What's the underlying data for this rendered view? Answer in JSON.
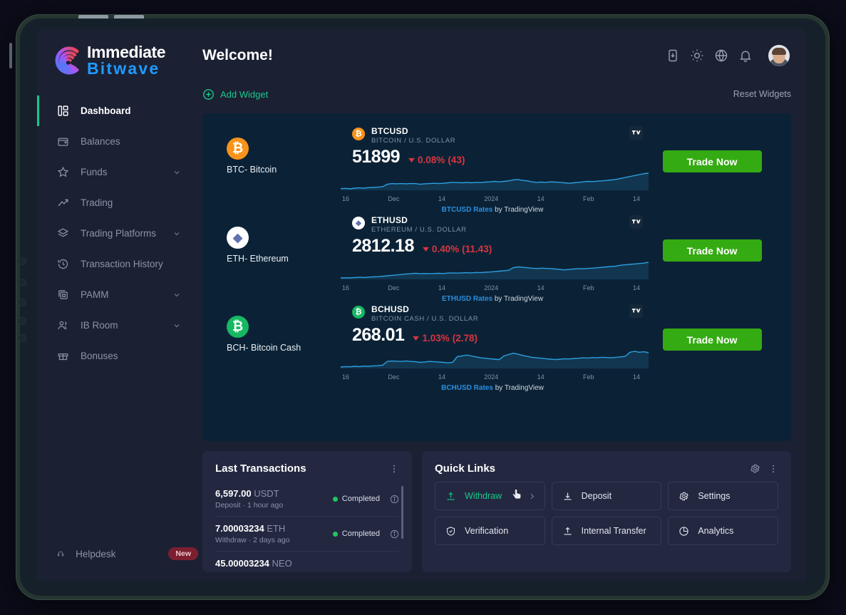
{
  "brand": {
    "line1": "Immediate",
    "line2": "Bitwave"
  },
  "header": {
    "title": "Welcome!",
    "icons": [
      "deposit-icon",
      "theme-sun-icon",
      "language-globe-icon",
      "notification-bell-icon"
    ],
    "avatar_alt": "user-avatar"
  },
  "widgetbar": {
    "add_label": "Add Widget",
    "reset_label": "Reset Widgets"
  },
  "sidebar": {
    "items": [
      {
        "label": "Dashboard",
        "icon": "dashboard-icon",
        "active": true,
        "expandable": false
      },
      {
        "label": "Balances",
        "icon": "wallet-icon",
        "active": false,
        "expandable": false
      },
      {
        "label": "Funds",
        "icon": "star-icon",
        "active": false,
        "expandable": true
      },
      {
        "label": "Trading",
        "icon": "trend-up-icon",
        "active": false,
        "expandable": false
      },
      {
        "label": "Trading Platforms",
        "icon": "layers-icon",
        "active": false,
        "expandable": true
      },
      {
        "label": "Transaction History",
        "icon": "history-clock-icon",
        "active": false,
        "expandable": false
      },
      {
        "label": "PAMM",
        "icon": "copy-box-icon",
        "active": false,
        "expandable": true
      },
      {
        "label": "IB Room",
        "icon": "users-icon",
        "active": false,
        "expandable": true
      },
      {
        "label": "Bonuses",
        "icon": "gift-icon",
        "active": false,
        "expandable": false
      }
    ],
    "helpdesk": {
      "label": "Helpdesk",
      "icon": "headset-icon",
      "badge": "New"
    }
  },
  "market": {
    "trade_button_label": "Trade Now",
    "credit_suffix": "by TradingView",
    "rows": [
      {
        "coin_code": "BTC- Bitcoin",
        "coin_glyph": "₿",
        "coin_color": "#f7931a",
        "symbol": "BTCUSD",
        "description": "BITCOIN / U.S. DOLLAR",
        "price": "51899",
        "change_pct": "0.08%",
        "change_abs": "(43)",
        "credit_link": "BTCUSD Rates"
      },
      {
        "coin_code": "ETH- Ethereum",
        "coin_glyph": "♦",
        "coin_color": "#ffffff",
        "symbol": "ETHUSD",
        "description": "ETHEREUM / U.S. DOLLAR",
        "price": "2812.18",
        "change_pct": "0.40%",
        "change_abs": "(11.43)",
        "credit_link": "ETHUSD Rates"
      },
      {
        "coin_code": "BCH- Bitcoin Cash",
        "coin_glyph": "₿",
        "coin_color": "#16b862",
        "symbol": "BCHUSD",
        "description": "BITCOIN CASH / U.S. DOLLAR",
        "price": "268.01",
        "change_pct": "1.03%",
        "change_abs": "(2.78)",
        "credit_link": "BCHUSD Rates"
      }
    ]
  },
  "chart_data": [
    {
      "type": "area",
      "title": "BTCUSD",
      "xlabel": "",
      "ylabel": "",
      "tick_labels": [
        "16",
        "Dec",
        "14",
        "2024",
        "14",
        "Feb",
        "14"
      ],
      "line_color": "#2b9fe0",
      "values": [
        12,
        13,
        11,
        14,
        15,
        14,
        16,
        17,
        18,
        20,
        30,
        33,
        32,
        33,
        32,
        33,
        33,
        30,
        32,
        33,
        34,
        33,
        34,
        36,
        38,
        37,
        36,
        38,
        36,
        38,
        37,
        39,
        40,
        42,
        40,
        42,
        44,
        48,
        50,
        46,
        44,
        40,
        38,
        39,
        38,
        40,
        39,
        38,
        36,
        34,
        36,
        38,
        40,
        42,
        41,
        43,
        44,
        46,
        48,
        50,
        54,
        58,
        62,
        66,
        70,
        74,
        76
      ]
    },
    {
      "type": "area",
      "title": "ETHUSD",
      "xlabel": "",
      "ylabel": "",
      "tick_labels": [
        "16",
        "Dec",
        "14",
        "2024",
        "14",
        "Feb",
        "14"
      ],
      "line_color": "#2b9fe0",
      "values": [
        10,
        11,
        10,
        12,
        13,
        12,
        14,
        15,
        16,
        18,
        20,
        22,
        24,
        26,
        28,
        30,
        32,
        30,
        31,
        30,
        31,
        32,
        31,
        33,
        34,
        33,
        34,
        35,
        34,
        36,
        35,
        37,
        38,
        40,
        42,
        44,
        46,
        58,
        62,
        60,
        58,
        56,
        54,
        56,
        55,
        54,
        52,
        50,
        48,
        50,
        52,
        54,
        53,
        55,
        56,
        58,
        60,
        62,
        64,
        66,
        70,
        72,
        74,
        76,
        78,
        80,
        84
      ]
    },
    {
      "type": "area",
      "title": "BCHUSD",
      "xlabel": "",
      "ylabel": "",
      "tick_labels": [
        "16",
        "Dec",
        "14",
        "2024",
        "14",
        "Feb",
        "14"
      ],
      "line_color": "#2b9fe0",
      "values": [
        10,
        12,
        11,
        13,
        12,
        14,
        13,
        15,
        16,
        18,
        34,
        36,
        35,
        34,
        36,
        34,
        33,
        30,
        32,
        34,
        33,
        32,
        30,
        28,
        30,
        55,
        58,
        62,
        58,
        54,
        50,
        48,
        46,
        44,
        42,
        58,
        64,
        70,
        66,
        60,
        56,
        52,
        50,
        48,
        46,
        44,
        42,
        44,
        46,
        45,
        47,
        48,
        50,
        49,
        51,
        50,
        52,
        51,
        50,
        52,
        54,
        56,
        74,
        78,
        74,
        76,
        72
      ]
    }
  ],
  "transactions": {
    "title": "Last Transactions",
    "rows": [
      {
        "amount": "6,597.00",
        "currency": "USDT",
        "type": "Deposit",
        "time": "1 hour ago",
        "status": "Completed"
      },
      {
        "amount": "7.00003234",
        "currency": "ETH",
        "type": "Withdraw",
        "time": "2 days ago",
        "status": "Completed"
      },
      {
        "amount": "45.00003234",
        "currency": "NEO",
        "type": "",
        "time": "",
        "status": ""
      }
    ]
  },
  "quick_links": {
    "title": "Quick Links",
    "items": [
      {
        "label": "Withdraw",
        "icon": "arrow-up-tray-icon",
        "hovered": true
      },
      {
        "label": "Deposit",
        "icon": "arrow-down-tray-icon",
        "hovered": false
      },
      {
        "label": "Settings",
        "icon": "gear-icon",
        "hovered": false
      },
      {
        "label": "Verification",
        "icon": "shield-check-icon",
        "hovered": false
      },
      {
        "label": "Internal Transfer",
        "icon": "arrow-up-tray-icon",
        "hovered": false
      },
      {
        "label": "Analytics",
        "icon": "pie-chart-icon",
        "hovered": false
      }
    ]
  },
  "colors": {
    "accent_green": "#17c98c",
    "trade_green": "#34ab12",
    "down_red": "#d9353f",
    "panel_bg": "#232840",
    "app_bg": "#1c2033",
    "market_bg": "#0b2236"
  }
}
